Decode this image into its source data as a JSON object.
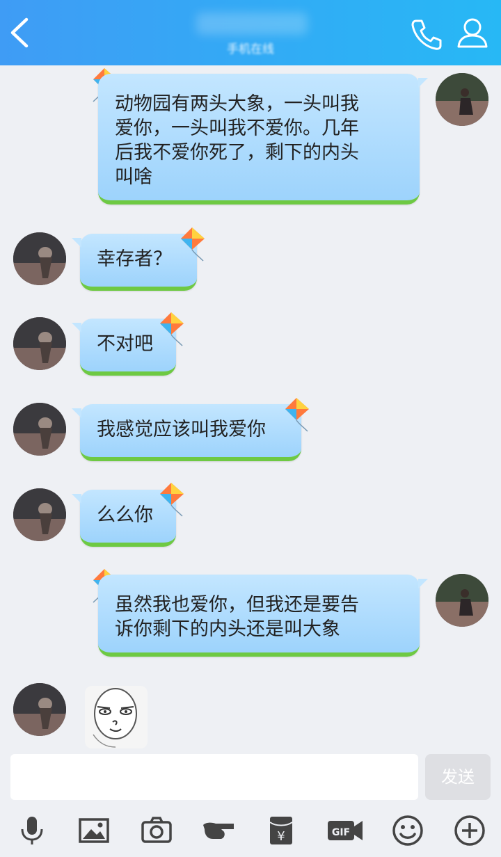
{
  "header": {
    "status": "手机在线"
  },
  "messages": [
    {
      "side": "right",
      "text": "动物园有两头大象，一头叫我\n爱你，一头叫我不爱你。几年\n后我不爱你死了，剩下的内头\n叫啥"
    },
    {
      "side": "left",
      "text": "幸存者？"
    },
    {
      "side": "left",
      "text": "不对吧"
    },
    {
      "side": "left",
      "text": "我感觉应该叫我爱你"
    },
    {
      "side": "left",
      "text": "么么你"
    },
    {
      "side": "right",
      "text": "虽然我也爱你，但我还是要告\n诉你剩下的内头还是叫大象"
    },
    {
      "side": "left",
      "type": "sticker"
    }
  ],
  "composer": {
    "input_value": "",
    "send_label": "发送"
  },
  "toolbar": [
    "mic-icon",
    "image-icon",
    "camera-icon",
    "poke-icon",
    "red-packet-icon",
    "gif-icon",
    "emoji-icon",
    "plus-icon"
  ],
  "colors": {
    "header_start": "#3f9cf5",
    "header_end": "#27b8f5",
    "bubble": "#a9d9fd",
    "grass": "#6ec943",
    "background": "#eef0f4"
  }
}
